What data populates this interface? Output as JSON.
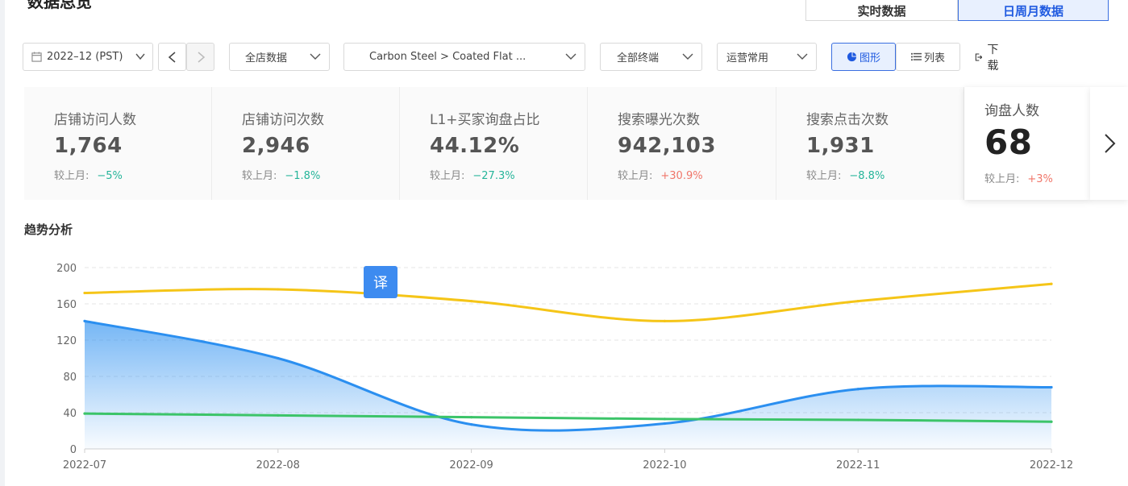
{
  "page": {
    "title": "数据总览"
  },
  "mode_tabs": [
    {
      "label": "实时数据",
      "active": false
    },
    {
      "label": "日周月数据",
      "active": true
    }
  ],
  "toolbar": {
    "date": {
      "value": "2022–12 (PST)"
    },
    "store_filter": {
      "value": "全店数据"
    },
    "category_filter": {
      "value": "Carbon Steel > Coated Flat ..."
    },
    "terminal_filter": {
      "value": "全部终端"
    },
    "metric_group": {
      "value": "运营常用"
    },
    "view_chart_label": "图形",
    "view_list_label": "列表",
    "download_label": "下载"
  },
  "kpis": [
    {
      "label": "店铺访问人数",
      "value": "1,764",
      "compare_label": "较上月:",
      "change": "−5%",
      "trend": "down"
    },
    {
      "label": "店铺访问次数",
      "value": "2,946",
      "compare_label": "较上月:",
      "change": "−1.8%",
      "trend": "down"
    },
    {
      "label": "L1+买家询盘占比",
      "value": "44.12%",
      "compare_label": "较上月:",
      "change": "−27.3%",
      "trend": "down"
    },
    {
      "label": "搜索曝光次数",
      "value": "942,103",
      "compare_label": "较上月:",
      "change": "+30.9%",
      "trend": "up"
    },
    {
      "label": "搜索点击次数",
      "value": "1,931",
      "compare_label": "较上月:",
      "change": "−8.8%",
      "trend": "down"
    },
    {
      "label": "询盘人数",
      "value": "68",
      "compare_label": "较上月:",
      "change": "+3%",
      "trend": "up",
      "active": true
    }
  ],
  "colors": {
    "down": "#26b59a",
    "up": "#f0766a",
    "accent": "#1f5ae0",
    "series_blue": "#2b8ff0",
    "series_yellow": "#f5c518",
    "series_green": "#3cc469"
  },
  "trend": {
    "title": "趋势分析"
  },
  "translate_badge": "译",
  "chart_data": {
    "type": "line",
    "title": "",
    "xlabel": "",
    "ylabel": "",
    "x": [
      "2022-07",
      "2022-08",
      "2022-09",
      "2022-10",
      "2022-11",
      "2022-12"
    ],
    "ylim": [
      0,
      200
    ],
    "yticks": [
      0,
      40,
      80,
      120,
      160,
      200
    ],
    "grid": true,
    "series": [
      {
        "color": "#f5c518",
        "fill": false,
        "values": [
          172,
          176,
          163,
          141,
          163,
          182
        ]
      },
      {
        "color": "#2b8ff0",
        "fill": true,
        "values": [
          141,
          100,
          27,
          28,
          66,
          68
        ]
      },
      {
        "color": "#3cc469",
        "fill": false,
        "values": [
          39,
          37,
          35,
          33,
          32,
          30
        ]
      }
    ]
  }
}
